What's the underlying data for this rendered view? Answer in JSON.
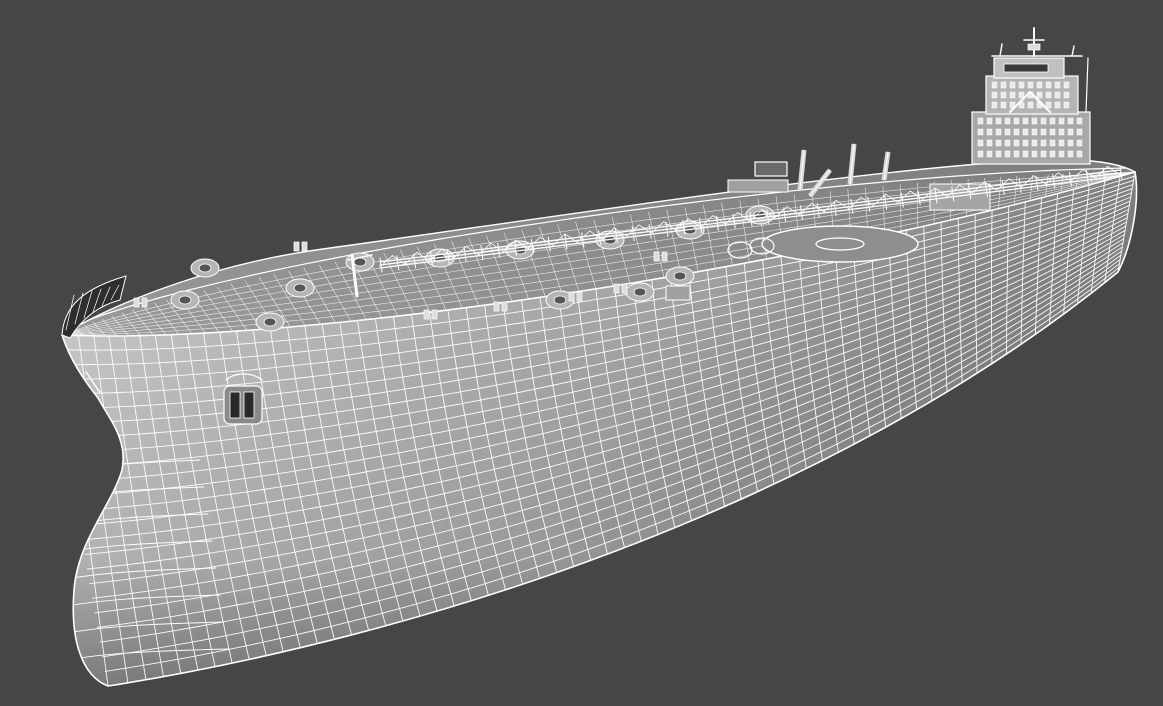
{
  "viewport": {
    "background_color": "#464646",
    "wireframe_color": "#ffffff",
    "hull_shade_light": "#c9c9c9",
    "hull_shade_mid": "#9a9a9a",
    "hull_shade_dark": "#5e5e5e",
    "deck_shade": "#8c8c8c"
  },
  "model": {
    "object": "oil-tanker-hull-wireframe",
    "parts": [
      "bow",
      "hull",
      "main-deck",
      "pipe-rack",
      "deck-cranes",
      "helipad",
      "superstructure",
      "radar-mast",
      "anchor-pocket"
    ]
  }
}
